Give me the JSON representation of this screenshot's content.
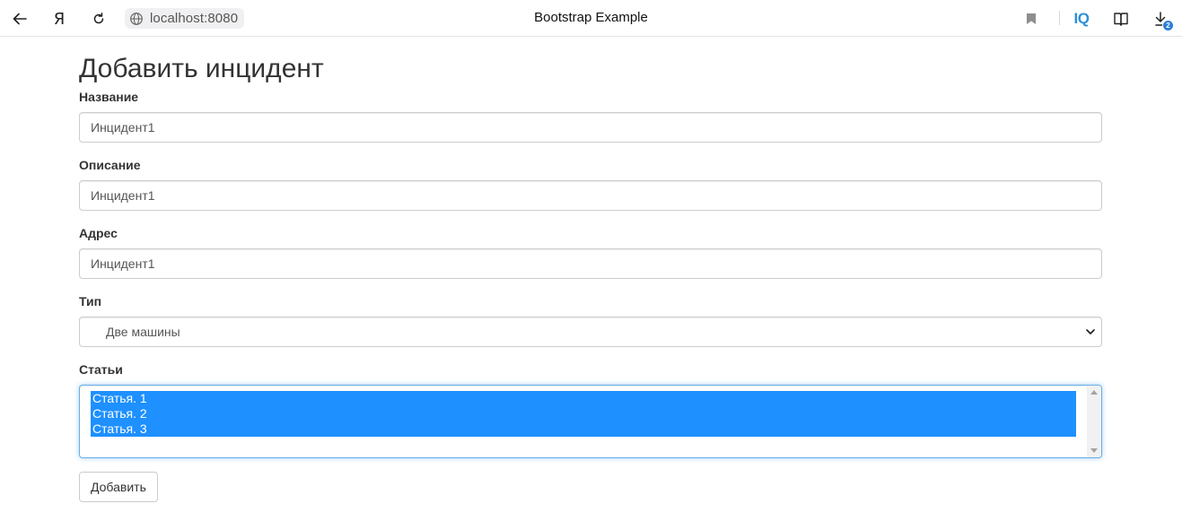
{
  "browser": {
    "address": "localhost:8080",
    "tab_title": "Bootstrap Example",
    "yandex_button": "Я",
    "iq_label": "IQ",
    "download_badge": "2",
    "accent_color": "#2c8fd6"
  },
  "form": {
    "heading": "Добавить инцидент",
    "name": {
      "label": "Название",
      "value": "Инцидент1"
    },
    "description": {
      "label": "Описание",
      "value": "Инцидент1"
    },
    "address": {
      "label": "Адрес",
      "value": "Инцидент1"
    },
    "type": {
      "label": "Тип",
      "selected": "Две машины"
    },
    "articles": {
      "label": "Статьи",
      "options": [
        "Статья. 1",
        "Статья. 2",
        "Статья. 3"
      ],
      "selection_color": "#1e90ff"
    },
    "submit_label": "Добавить"
  }
}
